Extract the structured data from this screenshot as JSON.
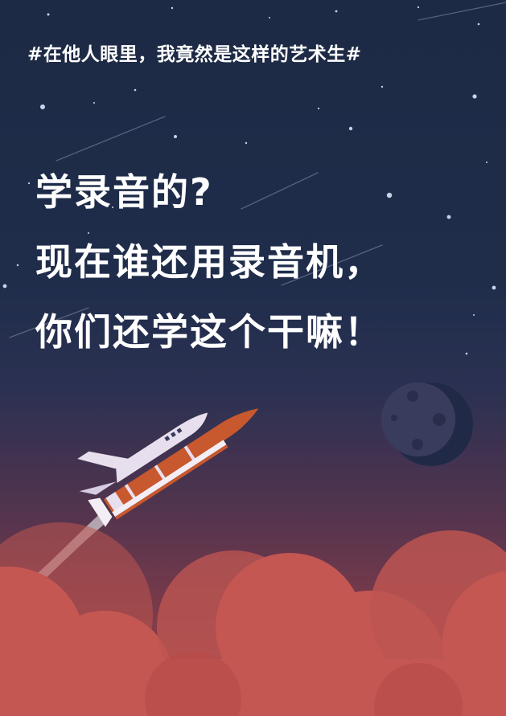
{
  "hashtag": "#在他人眼里，我竟然是这样的艺术生#",
  "headline": {
    "line1": "学录音的?",
    "line2": "现在谁还用录音机，",
    "line3": "你们还学这个干嘛！"
  },
  "colors": {
    "sky_top": "#1d2a45",
    "sky_bottom": "#a2464a",
    "cloud": "#c45752",
    "moon": "#2a3350",
    "rocket_body": "#c8582e",
    "shuttle": "#e8dfee"
  }
}
